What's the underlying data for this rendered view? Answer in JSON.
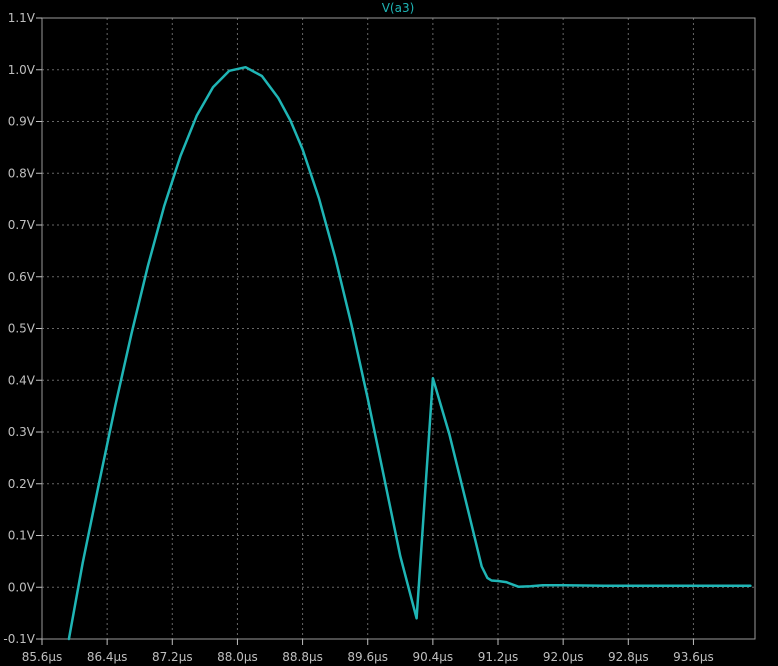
{
  "chart_data": {
    "type": "line",
    "title": "V(a3)",
    "xlabel": "",
    "ylabel": "",
    "xlim": [
      85.6,
      94.3
    ],
    "ylim": [
      -0.1,
      1.1
    ],
    "grid": true,
    "x_ticks": [
      "85.6µs",
      "86.4µs",
      "87.2µs",
      "88.0µs",
      "88.8µs",
      "89.6µs",
      "90.4µs",
      "91.2µs",
      "92.0µs",
      "92.8µs",
      "93.6µs"
    ],
    "x_tick_values": [
      85.6,
      86.4,
      87.2,
      88.0,
      88.8,
      89.6,
      90.4,
      91.2,
      92.0,
      92.8,
      93.6
    ],
    "y_ticks": [
      "-0.1V",
      "0.0V",
      "0.1V",
      "0.2V",
      "0.3V",
      "0.4V",
      "0.5V",
      "0.6V",
      "0.7V",
      "0.8V",
      "0.9V",
      "1.0V",
      "1.1V"
    ],
    "y_tick_values": [
      -0.1,
      0.0,
      0.1,
      0.2,
      0.3,
      0.4,
      0.5,
      0.6,
      0.7,
      0.8,
      0.9,
      1.0,
      1.1
    ],
    "series": [
      {
        "name": "V(a3)",
        "color": "#1fb5b5",
        "x": [
          85.93,
          86.1,
          86.3,
          86.5,
          86.7,
          86.9,
          87.1,
          87.3,
          87.5,
          87.7,
          87.9,
          88.1,
          88.3,
          88.5,
          88.65,
          88.8,
          89.0,
          89.2,
          89.4,
          89.6,
          89.8,
          90.0,
          90.2,
          90.4,
          90.6,
          90.8,
          91.0,
          91.07,
          91.12,
          91.2,
          91.3,
          91.45,
          91.6,
          91.75,
          92.0,
          92.5,
          93.0,
          93.5,
          94.3
        ],
        "y": [
          -0.1,
          0.047,
          0.201,
          0.351,
          0.491,
          0.621,
          0.736,
          0.833,
          0.911,
          0.966,
          0.998,
          1.005,
          0.988,
          0.946,
          0.902,
          0.846,
          0.752,
          0.638,
          0.508,
          0.365,
          0.213,
          0.06,
          -0.06,
          0.404,
          0.297,
          0.17,
          0.04,
          0.018,
          0.013,
          0.012,
          0.01,
          0.001,
          0.002,
          0.004,
          0.004,
          0.003,
          0.003,
          0.003,
          0.003
        ]
      }
    ]
  }
}
